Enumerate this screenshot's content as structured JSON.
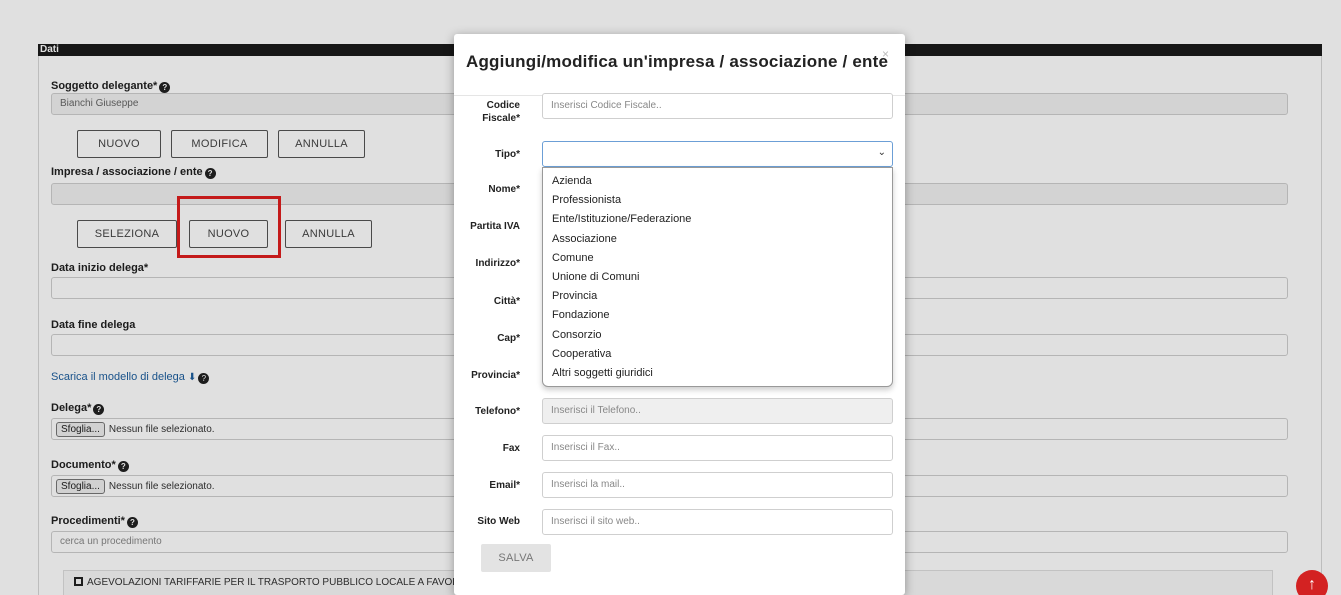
{
  "page": {
    "section_title": "Dati",
    "delegante_label": "Soggetto delegante*",
    "delegante_value": "Bianchi Giuseppe",
    "delegante_buttons": [
      "NUOVO",
      "MODIFICA",
      "ANNULLA"
    ],
    "impresa_label": "Impresa / associazione / ente",
    "impresa_buttons": [
      "SELEZIONA",
      "NUOVO",
      "ANNULLA"
    ],
    "data_inizio_label": "Data inizio delega*",
    "data_fine_label": "Data fine delega",
    "download_link": "Scarica il modello di delega",
    "delega_label": "Delega*",
    "documento_label": "Documento*",
    "browse_label": "Sfoglia...",
    "no_file_text": "Nessun file selezionato.",
    "procedimenti_label": "Procedimenti*",
    "procedimenti_placeholder": "cerca un procedimento",
    "procedimento_item": "AGEVOLAZIONI TARIFFARIE PER IL TRASPORTO PUBBLICO LOCALE A FAVORE DEGL"
  },
  "modal": {
    "title": "Aggiungi/modifica un'impresa / associazione / ente",
    "close": "×",
    "fields": {
      "codice_fiscale": {
        "label": "Codice Fiscale*",
        "placeholder": "Inserisci Codice Fiscale.."
      },
      "tipo": {
        "label": "Tipo*",
        "value": ""
      },
      "nome": {
        "label": "Nome*"
      },
      "partita_iva": {
        "label": "Partita IVA"
      },
      "indirizzo": {
        "label": "Indirizzo*"
      },
      "citta": {
        "label": "Città*"
      },
      "cap": {
        "label": "Cap*"
      },
      "provincia": {
        "label": "Provincia*"
      },
      "telefono": {
        "label": "Telefono*",
        "placeholder": "Inserisci il Telefono.."
      },
      "fax": {
        "label": "Fax",
        "placeholder": "Inserisci il Fax.."
      },
      "email": {
        "label": "Email*",
        "placeholder": "Inserisci la mail.."
      },
      "sito_web": {
        "label": "Sito Web",
        "placeholder": "Inserisci il sito web.."
      }
    },
    "tipo_options": [
      "Azienda",
      "Professionista",
      "Ente/Istituzione/Federazione",
      "Associazione",
      "Comune",
      "Unione di Comuni",
      "Provincia",
      "Fondazione",
      "Consorzio",
      "Cooperativa",
      "Altri soggetti giuridici"
    ],
    "save_label": "SALVA"
  },
  "icons": {
    "help": "question-circle-icon",
    "download": "download-icon",
    "scroll_top": "arrow-up-icon",
    "select": "chevron-down-icon"
  },
  "colors": {
    "highlight": "#e01e1e",
    "link": "#1d5e9e",
    "scroll_top_bg": "#d32222",
    "section_bar": "#1b1b1b"
  }
}
